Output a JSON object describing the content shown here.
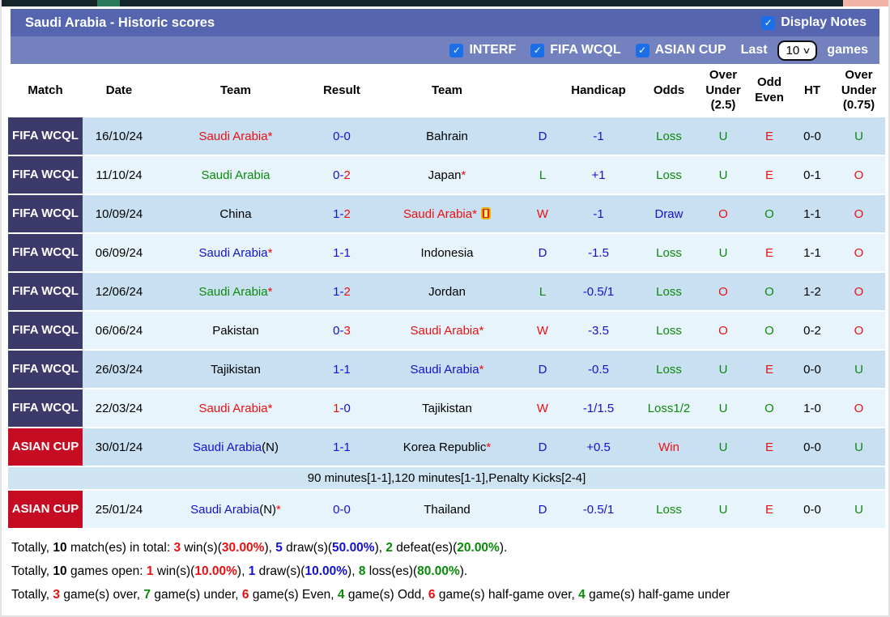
{
  "header": {
    "title": "Saudi Arabia - Historic scores",
    "display_notes_label": "Display Notes",
    "check_glyph": "✓",
    "chevron_glyph": "∨",
    "filters": [
      {
        "label": "INTERF",
        "checked": true
      },
      {
        "label": "FIFA WCQL",
        "checked": true
      },
      {
        "label": "ASIAN CUP",
        "checked": true
      }
    ],
    "last_label": "Last",
    "last_value": "10",
    "games_label": "games"
  },
  "table": {
    "columns": [
      "Match",
      "Date",
      "Team",
      "Result",
      "Team",
      "",
      "Handicap",
      "Odds",
      "Over Under (2.5)",
      "Odd Even",
      "HT",
      "Over Under (0.75)"
    ],
    "rows": [
      {
        "badge": {
          "text": "FIFA WCQL",
          "type": "fifa"
        },
        "date": "16/10/24",
        "home": [
          {
            "t": "Saudi Arabia*",
            "c": "red"
          }
        ],
        "result": [
          {
            "t": "0-0",
            "c": "blue"
          }
        ],
        "away": [
          {
            "t": "Bahrain",
            "c": "black"
          }
        ],
        "wdl": {
          "t": "D",
          "c": "blue"
        },
        "handicap": "-1",
        "odds": {
          "t": "Loss",
          "c": "green"
        },
        "ou25": {
          "t": "U",
          "c": "green"
        },
        "odd_even": {
          "t": "E",
          "c": "red"
        },
        "ht": "0-0",
        "ou075": {
          "t": "U",
          "c": "green"
        },
        "shade": "dark"
      },
      {
        "badge": {
          "text": "FIFA WCQL",
          "type": "fifa"
        },
        "date": "11/10/24",
        "home": [
          {
            "t": "Saudi Arabia",
            "c": "green"
          }
        ],
        "result": [
          {
            "t": "0-",
            "c": "blue"
          },
          {
            "t": "2",
            "c": "red"
          }
        ],
        "away": [
          {
            "t": "Japan",
            "c": "black"
          },
          {
            "t": "*",
            "c": "red"
          }
        ],
        "wdl": {
          "t": "L",
          "c": "green"
        },
        "handicap": "+1",
        "odds": {
          "t": "Loss",
          "c": "green"
        },
        "ou25": {
          "t": "U",
          "c": "green"
        },
        "odd_even": {
          "t": "E",
          "c": "red"
        },
        "ht": "0-1",
        "ou075": {
          "t": "O",
          "c": "red"
        },
        "shade": "light"
      },
      {
        "badge": {
          "text": "FIFA WCQL",
          "type": "fifa"
        },
        "date": "10/09/24",
        "home": [
          {
            "t": "China",
            "c": "black"
          }
        ],
        "result": [
          {
            "t": "1-",
            "c": "blue"
          },
          {
            "t": "2",
            "c": "red"
          }
        ],
        "away": [
          {
            "t": "Saudi Arabia*",
            "c": "red"
          },
          {
            "icon": "red-card"
          }
        ],
        "wdl": {
          "t": "W",
          "c": "red"
        },
        "handicap": "-1",
        "odds": {
          "t": "Draw",
          "c": "blue"
        },
        "ou25": {
          "t": "O",
          "c": "red"
        },
        "odd_even": {
          "t": "O",
          "c": "green"
        },
        "ht": "1-1",
        "ou075": {
          "t": "O",
          "c": "red"
        },
        "shade": "dark"
      },
      {
        "badge": {
          "text": "FIFA WCQL",
          "type": "fifa"
        },
        "date": "06/09/24",
        "home": [
          {
            "t": "Saudi Arabia",
            "c": "blue"
          },
          {
            "t": "*",
            "c": "red"
          }
        ],
        "result": [
          {
            "t": "1-1",
            "c": "blue"
          }
        ],
        "away": [
          {
            "t": "Indonesia",
            "c": "black"
          }
        ],
        "wdl": {
          "t": "D",
          "c": "blue"
        },
        "handicap": "-1.5",
        "odds": {
          "t": "Loss",
          "c": "green"
        },
        "ou25": {
          "t": "U",
          "c": "green"
        },
        "odd_even": {
          "t": "E",
          "c": "red"
        },
        "ht": "1-1",
        "ou075": {
          "t": "O",
          "c": "red"
        },
        "shade": "light"
      },
      {
        "badge": {
          "text": "FIFA WCQL",
          "type": "fifa"
        },
        "date": "12/06/24",
        "home": [
          {
            "t": "Saudi Arabia",
            "c": "green"
          },
          {
            "t": "*",
            "c": "red"
          }
        ],
        "result": [
          {
            "t": "1-",
            "c": "blue"
          },
          {
            "t": "2",
            "c": "red"
          }
        ],
        "away": [
          {
            "t": "Jordan",
            "c": "black"
          }
        ],
        "wdl": {
          "t": "L",
          "c": "green"
        },
        "handicap": "-0.5/1",
        "odds": {
          "t": "Loss",
          "c": "green"
        },
        "ou25": {
          "t": "O",
          "c": "red"
        },
        "odd_even": {
          "t": "O",
          "c": "green"
        },
        "ht": "1-2",
        "ou075": {
          "t": "O",
          "c": "red"
        },
        "shade": "dark"
      },
      {
        "badge": {
          "text": "FIFA WCQL",
          "type": "fifa"
        },
        "date": "06/06/24",
        "home": [
          {
            "t": "Pakistan",
            "c": "black"
          }
        ],
        "result": [
          {
            "t": "0-",
            "c": "blue"
          },
          {
            "t": "3",
            "c": "red"
          }
        ],
        "away": [
          {
            "t": "Saudi Arabia*",
            "c": "red"
          }
        ],
        "wdl": {
          "t": "W",
          "c": "red"
        },
        "handicap": "-3.5",
        "odds": {
          "t": "Loss",
          "c": "green"
        },
        "ou25": {
          "t": "O",
          "c": "red"
        },
        "odd_even": {
          "t": "O",
          "c": "green"
        },
        "ht": "0-2",
        "ou075": {
          "t": "O",
          "c": "red"
        },
        "shade": "light"
      },
      {
        "badge": {
          "text": "FIFA WCQL",
          "type": "fifa"
        },
        "date": "26/03/24",
        "home": [
          {
            "t": "Tajikistan",
            "c": "black"
          }
        ],
        "result": [
          {
            "t": "1-1",
            "c": "blue"
          }
        ],
        "away": [
          {
            "t": "Saudi Arabia",
            "c": "blue"
          },
          {
            "t": "*",
            "c": "red"
          }
        ],
        "wdl": {
          "t": "D",
          "c": "blue"
        },
        "handicap": "-0.5",
        "odds": {
          "t": "Loss",
          "c": "green"
        },
        "ou25": {
          "t": "U",
          "c": "green"
        },
        "odd_even": {
          "t": "E",
          "c": "red"
        },
        "ht": "0-0",
        "ou075": {
          "t": "U",
          "c": "green"
        },
        "shade": "dark"
      },
      {
        "badge": {
          "text": "FIFA WCQL",
          "type": "fifa"
        },
        "date": "22/03/24",
        "home": [
          {
            "t": "Saudi Arabia*",
            "c": "red"
          }
        ],
        "result": [
          {
            "t": "1",
            "c": "red"
          },
          {
            "t": "-0",
            "c": "blue"
          }
        ],
        "away": [
          {
            "t": "Tajikistan",
            "c": "black"
          }
        ],
        "wdl": {
          "t": "W",
          "c": "red"
        },
        "handicap": "-1/1.5",
        "odds": {
          "t": "Loss1/2",
          "c": "green"
        },
        "ou25": {
          "t": "U",
          "c": "green"
        },
        "odd_even": {
          "t": "O",
          "c": "green"
        },
        "ht": "1-0",
        "ou075": {
          "t": "O",
          "c": "red"
        },
        "shade": "light"
      },
      {
        "badge": {
          "text": "ASIAN CUP",
          "type": "asian"
        },
        "date": "30/01/24",
        "home": [
          {
            "t": "Saudi Arabia",
            "c": "blue"
          },
          {
            "t": "(N)",
            "c": "black"
          }
        ],
        "result": [
          {
            "t": "1-1",
            "c": "blue"
          }
        ],
        "away": [
          {
            "t": "Korea Republic",
            "c": "black"
          },
          {
            "t": "*",
            "c": "red"
          }
        ],
        "wdl": {
          "t": "D",
          "c": "blue"
        },
        "handicap": "+0.5",
        "odds": {
          "t": "Win",
          "c": "red"
        },
        "ou25": {
          "t": "U",
          "c": "green"
        },
        "odd_even": {
          "t": "E",
          "c": "red"
        },
        "ht": "0-0",
        "ou075": {
          "t": "U",
          "c": "green"
        },
        "shade": "dark"
      },
      {
        "type": "note",
        "text": "90 minutes[1-1],120 minutes[1-1],Penalty Kicks[2-4]"
      },
      {
        "badge": {
          "text": "ASIAN CUP",
          "type": "asian"
        },
        "date": "25/01/24",
        "home": [
          {
            "t": "Saudi Arabia",
            "c": "blue"
          },
          {
            "t": "(N)",
            "c": "black"
          },
          {
            "t": "*",
            "c": "red"
          }
        ],
        "result": [
          {
            "t": "0-0",
            "c": "blue"
          }
        ],
        "away": [
          {
            "t": "Thailand",
            "c": "black"
          }
        ],
        "wdl": {
          "t": "D",
          "c": "blue"
        },
        "handicap": "-0.5/1",
        "odds": {
          "t": "Loss",
          "c": "green"
        },
        "ou25": {
          "t": "U",
          "c": "green"
        },
        "odd_even": {
          "t": "E",
          "c": "red"
        },
        "ht": "0-0",
        "ou075": {
          "t": "U",
          "c": "green"
        },
        "shade": "light"
      }
    ]
  },
  "footer": {
    "lines": [
      [
        {
          "t": "Totally, "
        },
        {
          "t": "10",
          "b": true
        },
        {
          "t": " match(es) in total: "
        },
        {
          "t": "3",
          "c": "red",
          "b": true
        },
        {
          "t": " win(s)("
        },
        {
          "t": "30.00%",
          "c": "red",
          "b": true
        },
        {
          "t": "), "
        },
        {
          "t": "5",
          "c": "blue",
          "b": true
        },
        {
          "t": " draw(s)("
        },
        {
          "t": "50.00%",
          "c": "blue",
          "b": true
        },
        {
          "t": "), "
        },
        {
          "t": "2",
          "c": "green",
          "b": true
        },
        {
          "t": " defeat(es)("
        },
        {
          "t": "20.00%",
          "c": "green",
          "b": true
        },
        {
          "t": ")."
        }
      ],
      [
        {
          "t": "Totally, "
        },
        {
          "t": "10",
          "b": true
        },
        {
          "t": " games open: "
        },
        {
          "t": "1",
          "c": "red",
          "b": true
        },
        {
          "t": " win(s)("
        },
        {
          "t": "10.00%",
          "c": "red",
          "b": true
        },
        {
          "t": "), "
        },
        {
          "t": "1",
          "c": "blue",
          "b": true
        },
        {
          "t": " draw(s)("
        },
        {
          "t": "10.00%",
          "c": "blue",
          "b": true
        },
        {
          "t": "), "
        },
        {
          "t": "8",
          "c": "green",
          "b": true
        },
        {
          "t": " loss(es)("
        },
        {
          "t": "80.00%",
          "c": "green",
          "b": true
        },
        {
          "t": ")."
        }
      ],
      [
        {
          "t": "Totally, "
        },
        {
          "t": "3",
          "c": "red",
          "b": true
        },
        {
          "t": " game(s) over, "
        },
        {
          "t": "7",
          "c": "green",
          "b": true
        },
        {
          "t": " game(s) under, "
        },
        {
          "t": "6",
          "c": "red",
          "b": true
        },
        {
          "t": " game(s) Even, "
        },
        {
          "t": "4",
          "c": "green",
          "b": true
        },
        {
          "t": " game(s) Odd, "
        },
        {
          "t": "6",
          "c": "red",
          "b": true
        },
        {
          "t": " game(s) half-game over, "
        },
        {
          "t": "4",
          "c": "green",
          "b": true
        },
        {
          "t": " game(s) half-game under"
        }
      ]
    ]
  },
  "colors": {
    "bar1": "#5565b0",
    "bar2": "#7381bf",
    "badge_fifa": "#3c3a6b",
    "badge_asian": "#c60c22",
    "row_dark": "#c9e0f2",
    "row_light": "#e8f4fb",
    "checkbox_blue": "#1a6fe8",
    "text_blue": "#1212d0",
    "text_red": "#e81010",
    "text_green": "#0a8a0a"
  }
}
